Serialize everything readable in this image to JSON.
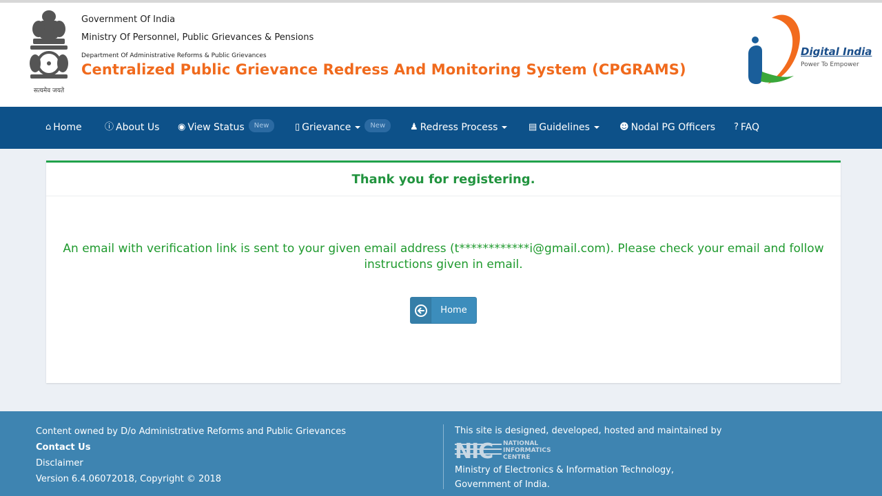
{
  "header": {
    "line1": "Government Of India",
    "line2": "Ministry Of Personnel, Public Grievances & Pensions",
    "line3": "Department Of Administrative Reforms & Public Grievances",
    "title": "Centralized Public Grievance Redress And Monitoring System (CPGRAMS)",
    "emblem_motto": "सत्यमेव जयते",
    "digital_india_title": "Digital India",
    "digital_india_sub": "Power To Empower"
  },
  "nav": {
    "items": [
      {
        "label": "Home",
        "icon": "home-icon"
      },
      {
        "label": "About Us",
        "icon": "info-icon"
      },
      {
        "label": "View Status",
        "icon": "eye-icon",
        "badge": "New"
      },
      {
        "label": "Grievance",
        "icon": "file-icon",
        "badge": "New",
        "dropdown": true
      },
      {
        "label": "Redress Process",
        "icon": "sitemap-icon",
        "dropdown": true
      },
      {
        "label": "Guidelines",
        "icon": "book-icon",
        "dropdown": true
      },
      {
        "label": "Nodal PG Officers",
        "icon": "users-icon"
      },
      {
        "label": "FAQ",
        "icon": "question-icon"
      }
    ]
  },
  "card": {
    "heading": "Thank you for registering.",
    "message": "An email with verification link is sent to your given email address (t************i@gmail.com). Please check your email and follow instructions given in email.",
    "home_button": "Home"
  },
  "footer": {
    "content_owned": "Content owned by D/o Administrative Reforms and Public Grievances",
    "contact": "Contact Us",
    "disclaimer": "Disclaimer",
    "version": "Version 6.4.06072018, Copyright © 2018",
    "designed_by": "This site is designed, developed, hosted and maintained by",
    "nic_name": "NATIONAL INFORMATICS CENTRE",
    "ministry": "Ministry of Electronics & Information Technology,",
    "government": "Government of India."
  },
  "colors": {
    "nav_bg": "#0d5189",
    "title_orange": "#f06a1d",
    "success_green": "#21a24b",
    "footer_bg": "#3e84b1",
    "button_blue": "#3c8dbc"
  }
}
